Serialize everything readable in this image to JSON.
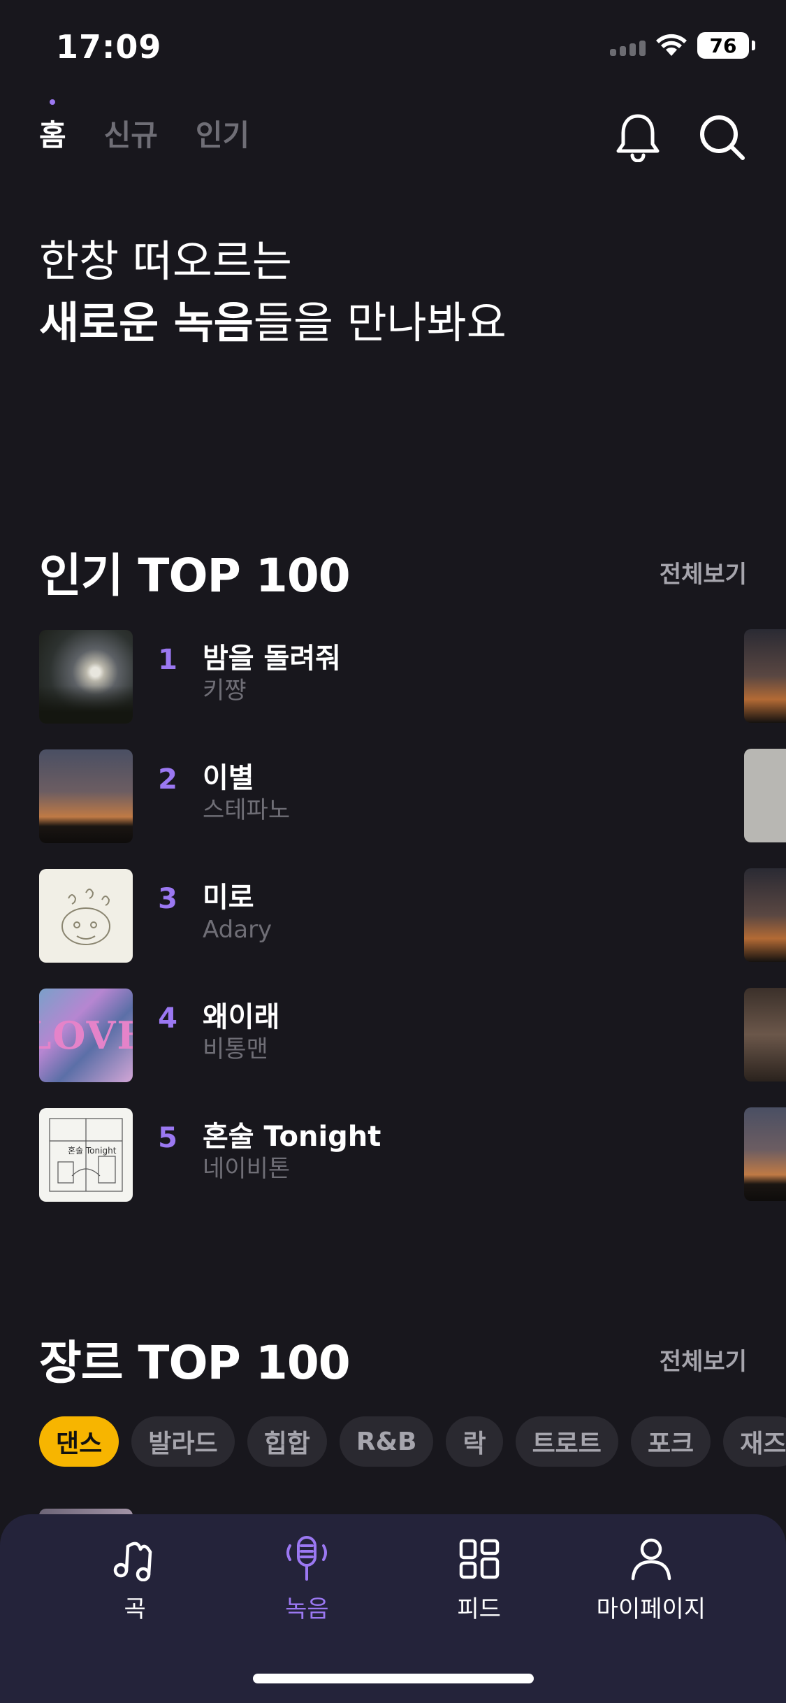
{
  "status_bar": {
    "time": "17:09",
    "battery": "76"
  },
  "top_nav": {
    "tabs": [
      {
        "label": "홈",
        "active": true
      },
      {
        "label": "신규",
        "active": false
      },
      {
        "label": "인기",
        "active": false
      }
    ],
    "icons": [
      "bell-icon",
      "search-icon"
    ]
  },
  "hero": {
    "line1": "한창 떠오르는",
    "line2_strong": "새로운 녹음",
    "line2_rest": "들을 만나봐요"
  },
  "popular": {
    "title": "인기 TOP 100",
    "see_all": "전체보기",
    "items": [
      {
        "rank": "1",
        "title": "밤을 돌려줘",
        "artist": "키쨩"
      },
      {
        "rank": "2",
        "title": "이별",
        "artist": "스테파노"
      },
      {
        "rank": "3",
        "title": "미로",
        "artist": "Adary"
      },
      {
        "rank": "4",
        "title": "왜이래",
        "artist": "비통맨",
        "cover_text": "LOVE"
      },
      {
        "rank": "5",
        "title": "혼술 Tonight",
        "artist": "네이비톤"
      }
    ]
  },
  "genre": {
    "title": "장르 TOP 100",
    "see_all": "전체보기",
    "chips": [
      "댄스",
      "발라드",
      "힙합",
      "R&B",
      "락",
      "트로트",
      "포크",
      "재즈"
    ]
  },
  "colors": {
    "accent": "#9b78f2",
    "chip_active": "#f7b500",
    "background": "#18171d"
  },
  "bottom_tabs": [
    {
      "label": "곡",
      "icon": "music-note-icon",
      "active": false
    },
    {
      "label": "녹음",
      "icon": "microphone-icon",
      "active": true
    },
    {
      "label": "피드",
      "icon": "grid-icon",
      "active": false
    },
    {
      "label": "마이페이지",
      "icon": "person-icon",
      "active": false
    }
  ]
}
